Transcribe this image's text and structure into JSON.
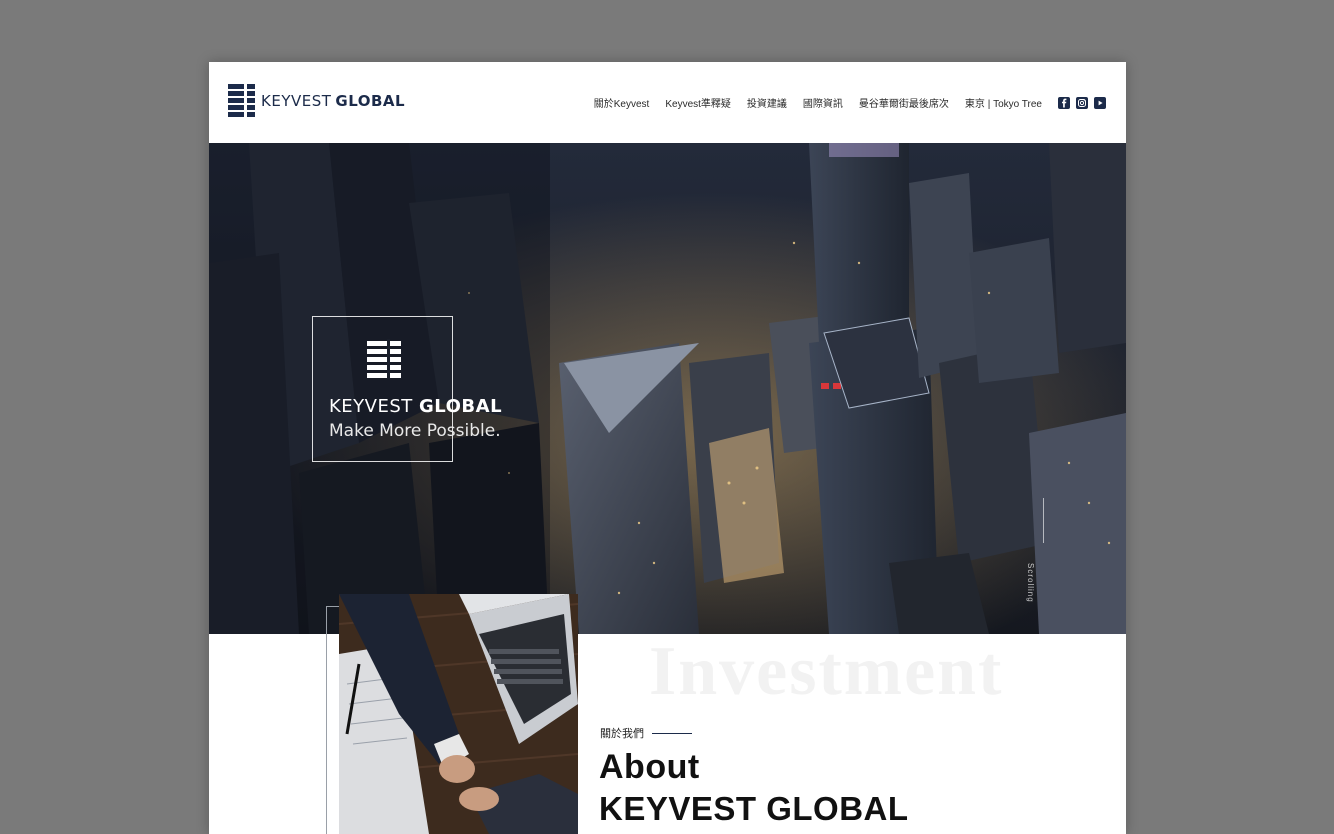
{
  "brand": {
    "name_light": "KEYVEST",
    "name_bold": "GLOBAL",
    "color": "#1c2b4a"
  },
  "nav": {
    "items": [
      {
        "label": "關於Keyvest"
      },
      {
        "label": "Keyvest準釋疑"
      },
      {
        "label": "投資建議"
      },
      {
        "label": "國際資訊"
      },
      {
        "label": "曼谷華爾街最後席次"
      },
      {
        "label": "東京 | Tokyo Tree"
      }
    ],
    "social": [
      {
        "icon": "facebook-icon",
        "glyph": "f"
      },
      {
        "icon": "instagram-icon",
        "glyph": "◎"
      },
      {
        "icon": "youtube-icon",
        "glyph": "▶"
      }
    ]
  },
  "hero": {
    "brand_light": "KEYVEST",
    "brand_bold": "GLOBAL",
    "tagline": "Make More Possible.",
    "scroll_label": "Scrolling"
  },
  "about": {
    "watermark": "Investment",
    "label": "關於我們",
    "title_line1": "About",
    "title_line2": "KEYVEST GLOBAL"
  }
}
